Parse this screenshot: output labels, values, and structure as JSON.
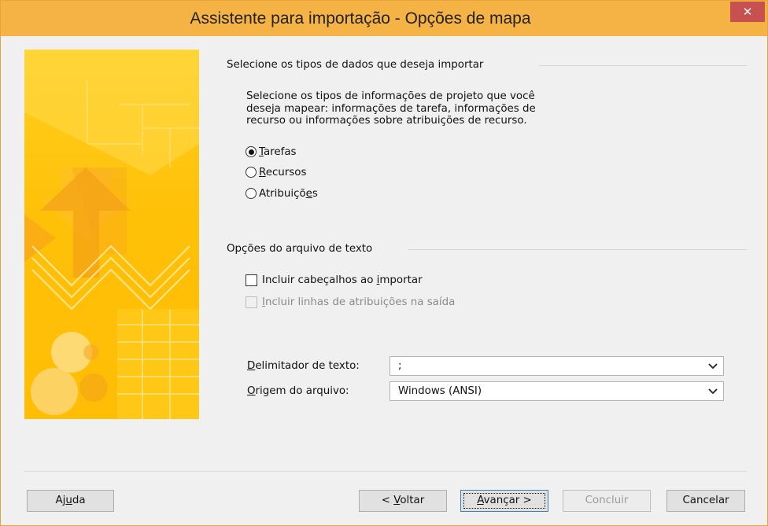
{
  "window": {
    "title": "Assistente para importação - Opções de mapa",
    "close_label": "✕"
  },
  "section1": {
    "heading": "Selecione os tipos de dados que deseja importar",
    "description": [
      "Selecione os tipos de informações de projeto que você",
      "deseja mapear: informações de tarefa, informações de",
      "recurso ou informações sobre atribuições de recurso."
    ],
    "options": [
      {
        "pre": "",
        "key": "T",
        "post": "arefas",
        "selected": true
      },
      {
        "pre": "",
        "key": "R",
        "post": "ecursos",
        "selected": false
      },
      {
        "pre": "Atribuiçõ",
        "key": "e",
        "post": "s",
        "selected": false
      }
    ]
  },
  "section2": {
    "heading": "Opções do arquivo de texto",
    "include_headers": {
      "pre": "Incluir cabeçalhos ao ",
      "key": "i",
      "post": "mportar",
      "checked": false,
      "enabled": true
    },
    "include_assignments": {
      "pre": "",
      "key": "I",
      "post": "ncluir linhas de atribuições na saída",
      "checked": false,
      "enabled": false
    },
    "delimiter": {
      "label_key": "D",
      "label_rest": "elimitador de texto:",
      "value": ";"
    },
    "origin": {
      "label_key": "O",
      "label_rest": "rigem do arquivo:",
      "value": "Windows (ANSI)"
    }
  },
  "buttons": {
    "help": {
      "pre": "Aj",
      "key": "u",
      "post": "da"
    },
    "back": {
      "pre": "< ",
      "key": "V",
      "post": "oltar"
    },
    "next": {
      "pre": "",
      "key": "A",
      "post": "vançar >"
    },
    "finish": {
      "pre": "",
      "key": "",
      "post": "Concluir"
    },
    "cancel": {
      "pre": "",
      "key": "",
      "post": "Cancelar"
    }
  },
  "colors": {
    "titlebar": "#f6b345",
    "close": "#c75050",
    "accent": "#3c7fb1"
  }
}
